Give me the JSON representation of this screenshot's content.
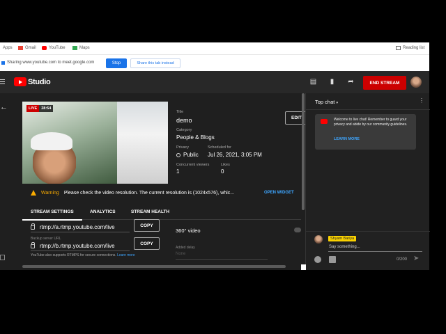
{
  "bookmarks": [
    {
      "label": "Apps",
      "color": "#1a73e8"
    },
    {
      "label": "Gmail",
      "color": "#ea4335"
    },
    {
      "label": "YouTube",
      "color": "#ff0000"
    },
    {
      "label": "Maps",
      "color": "#34a853"
    }
  ],
  "reading_list": "Reading list",
  "share_bar": {
    "message": "Sharing www.youtube.com to meet.google.com",
    "stop": "Stop",
    "share_instead": "Share this tab instead"
  },
  "header": {
    "studio_label": "Studio",
    "end_stream": "END STREAM"
  },
  "video": {
    "live_badge": "LIVE",
    "elapsed": "28:54"
  },
  "details": {
    "title_label": "Title",
    "title": "demo",
    "category_label": "Category",
    "category": "People & Blogs",
    "privacy_label": "Privacy",
    "privacy": "Public",
    "scheduled_label": "Scheduled for",
    "scheduled": "Jul 26, 2021, 3:05 PM",
    "viewers_label": "Concurrent viewers",
    "viewers": "1",
    "likes_label": "Likes",
    "likes": "0",
    "edit": "EDIT"
  },
  "warning": {
    "label": "Warning",
    "message": "Please check the video resolution. The current resolution is (1024x576), whic...",
    "action": "OPEN WIDGET"
  },
  "tabs": [
    "STREAM SETTINGS",
    "ANALYTICS",
    "STREAM HEALTH"
  ],
  "stream_settings": {
    "primary_url": "rtmp://a.rtmp.youtube.com/live",
    "backup_label": "Backup server URL",
    "backup_url": "rtmp://b.rtmp.youtube.com/live",
    "copy": "COPY",
    "rtmps_note": "YouTube also supports RTMPS for secure connections.",
    "learn_more": "Learn more",
    "video_360": "360° video",
    "added_delay": "Added delay",
    "delay_value": "None"
  },
  "chat": {
    "mode": "Top chat",
    "welcome": "Welcome to live chat! Remember to guard your privacy and abide by our community guidelines.",
    "learn_more": "LEARN MORE",
    "user_name": "Shyam Bariya",
    "placeholder": "Say something...",
    "counter": "0/200"
  }
}
